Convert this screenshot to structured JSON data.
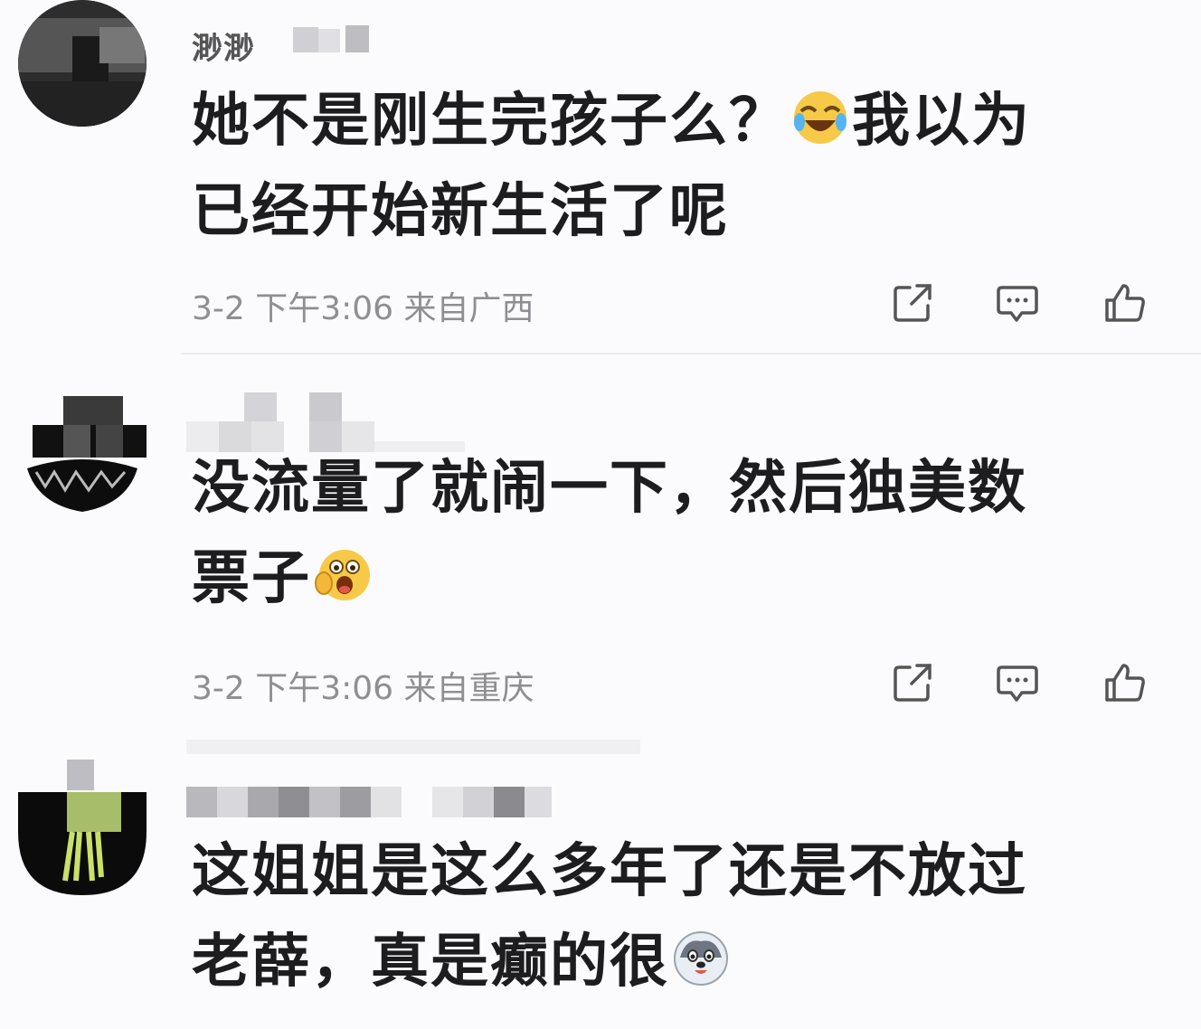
{
  "comments": [
    {
      "username": "渺渺",
      "text_line1": "她不是刚生完孩子么？",
      "text_line1b": "我以为",
      "text_line2": "已经开始新生活了呢",
      "emoji": "laugh-cry-emoji",
      "meta": "3-2 下午3:06 来自广西"
    },
    {
      "text_line1": "没流量了就闹一下，然后独美数",
      "text_line2": "票子",
      "emoji": "excited-face-emoji",
      "meta": "3-2 下午3:06 来自重庆"
    },
    {
      "text_line1": "这姐姐是这么多年了还是不放过",
      "text_line2": "老薛，真是癫的很",
      "emoji": "husky-face-emoji"
    }
  ],
  "icons": {
    "share": "share-icon",
    "comment": "comment-bubble-icon",
    "like": "thumb-up-icon"
  },
  "colors": {
    "background": "#fbfbfd",
    "text": "#1d1d1f",
    "meta": "#8e8e93",
    "icon": "#555555"
  }
}
